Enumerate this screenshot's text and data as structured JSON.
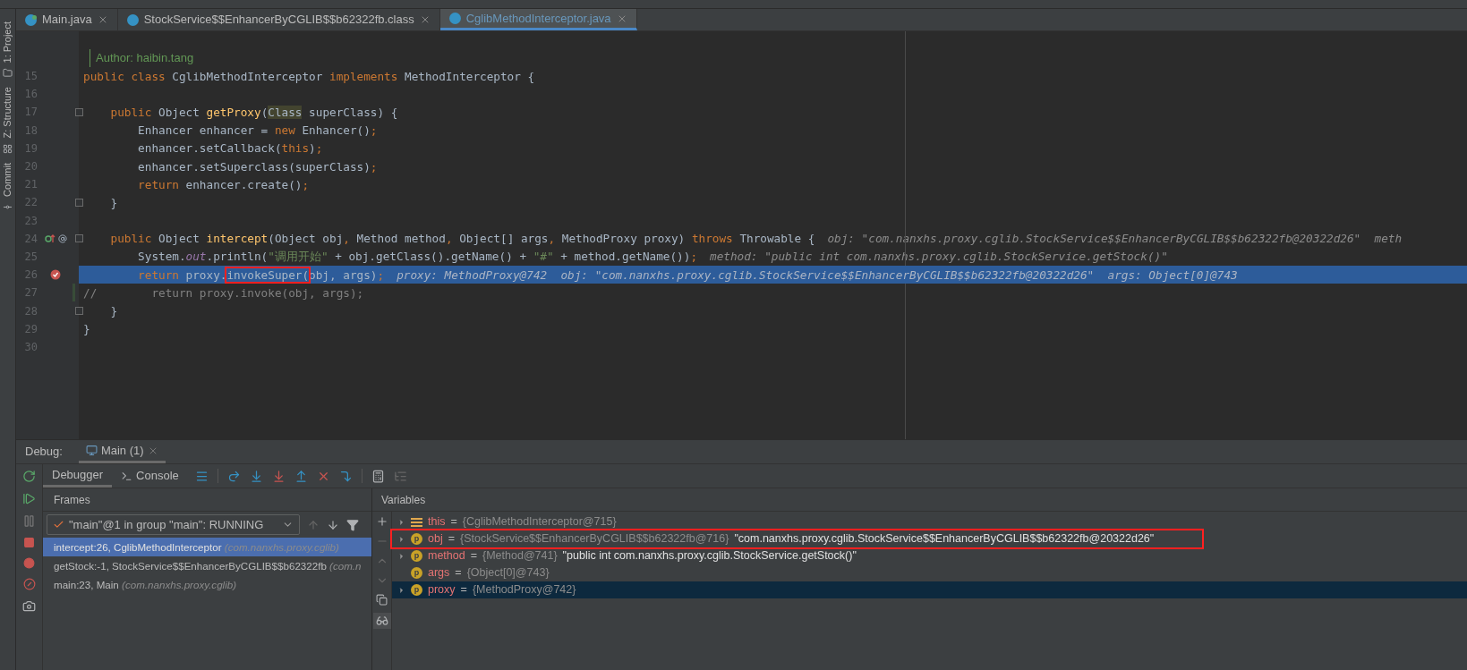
{
  "tool_strip": [
    {
      "label": "1: Project",
      "kind": "project"
    },
    {
      "label": "Z: Structure",
      "kind": "structure"
    },
    {
      "label": "Commit",
      "kind": "commit"
    }
  ],
  "editor_tabs": [
    {
      "label": "Main.java",
      "selected": false,
      "kind": "runnable"
    },
    {
      "label": "StockService$$EnhancerByCGLIB$$b62322fb.class",
      "selected": false,
      "kind": "class"
    },
    {
      "label": "CglibMethodInterceptor.java",
      "selected": true,
      "kind": "class"
    }
  ],
  "doc_lines": [
    "Author: haibin.tang"
  ],
  "code_lines": [
    {
      "number": "15",
      "tokens": [
        {
          "t": "public class ",
          "kind": "kw"
        },
        {
          "t": "CglibMethodInterceptor ",
          "kind": "plain"
        },
        {
          "t": "implements ",
          "kind": "kw"
        },
        {
          "t": "MethodInterceptor {",
          "kind": "plain"
        }
      ]
    },
    {
      "number": "16"
    },
    {
      "number": "17",
      "fold": true,
      "tokens": [
        {
          "t": "    public ",
          "kind": "kw"
        },
        {
          "t": "Object ",
          "kind": "plain"
        },
        {
          "t": "getProxy",
          "kind": "fn"
        },
        {
          "t": "(",
          "kind": "plain"
        },
        {
          "t": "Class",
          "kind": "plain",
          "marked": true
        },
        {
          "t": " superClass) {",
          "kind": "plain"
        }
      ]
    },
    {
      "number": "18",
      "tokens": [
        {
          "t": "        Enhancer enhancer = ",
          "kind": "plain"
        },
        {
          "t": "new ",
          "kind": "kw"
        },
        {
          "t": "Enhancer()",
          "kind": "plain"
        },
        {
          "t": ";",
          "kind": "kw"
        }
      ]
    },
    {
      "number": "19",
      "tokens": [
        {
          "t": "        enhancer.setCallback(",
          "kind": "plain"
        },
        {
          "t": "this",
          "kind": "kw"
        },
        {
          "t": ")",
          "kind": "plain"
        },
        {
          "t": ";",
          "kind": "kw"
        }
      ]
    },
    {
      "number": "20",
      "tokens": [
        {
          "t": "        enhancer.setSuperclass(superClass)",
          "kind": "plain"
        },
        {
          "t": ";",
          "kind": "kw"
        }
      ]
    },
    {
      "number": "21",
      "tokens": [
        {
          "t": "        return ",
          "kind": "kw"
        },
        {
          "t": "enhancer.create()",
          "kind": "plain"
        },
        {
          "t": ";",
          "kind": "kw"
        }
      ]
    },
    {
      "number": "22",
      "fold": true,
      "tokens": [
        {
          "t": "    }",
          "kind": "plain"
        }
      ]
    },
    {
      "number": "23"
    },
    {
      "number": "24",
      "fold": true,
      "kind": "implements",
      "tokens": [
        {
          "t": "    public ",
          "kind": "kw"
        },
        {
          "t": "Object ",
          "kind": "plain"
        },
        {
          "t": "intercept",
          "kind": "fn"
        },
        {
          "t": "(Object obj",
          "kind": "plain"
        },
        {
          "t": ", ",
          "kind": "kw"
        },
        {
          "t": "Method method",
          "kind": "plain"
        },
        {
          "t": ", ",
          "kind": "kw"
        },
        {
          "t": "Object[] args",
          "kind": "plain"
        },
        {
          "t": ", ",
          "kind": "kw"
        },
        {
          "t": "MethodProxy proxy) ",
          "kind": "plain"
        },
        {
          "t": "throws ",
          "kind": "kw"
        },
        {
          "t": "Throwable {",
          "kind": "plain"
        }
      ],
      "hint": "obj: \"com.nanxhs.proxy.cglib.StockService$$EnhancerByCGLIB$$b62322fb@20322d26\"  meth"
    },
    {
      "number": "25",
      "tokens": [
        {
          "t": "        System.",
          "kind": "plain"
        },
        {
          "t": "out",
          "kind": "static"
        },
        {
          "t": ".println(",
          "kind": "plain"
        },
        {
          "t": "\"调用开始\"",
          "kind": "str"
        },
        {
          "t": " + obj.getClass().getName() + ",
          "kind": "plain"
        },
        {
          "t": "\"#\"",
          "kind": "str"
        },
        {
          "t": " + method.getName())",
          "kind": "plain"
        },
        {
          "t": ";",
          "kind": "kw"
        }
      ],
      "hint": "method: \"public int com.nanxhs.proxy.cglib.StockService.getStock()\""
    },
    {
      "number": "26",
      "current": true,
      "kind": "breakpoint",
      "tokens": [
        {
          "t": "        return ",
          "kind": "kw"
        },
        {
          "t": "proxy.",
          "kind": "plain"
        },
        {
          "t": "invokeSuper(",
          "kind": "plain",
          "boxed": true
        },
        {
          "t": "obj, args)",
          "kind": "plain"
        },
        {
          "t": ";",
          "kind": "kw"
        }
      ],
      "hint": "proxy: MethodProxy@742  obj: \"com.nanxhs.proxy.cglib.StockService$$EnhancerByCGLIB$$b62322fb@20322d26\"  args: Object[0]@743"
    },
    {
      "number": "27",
      "changed": true,
      "tokens": [
        {
          "t": "//        return proxy.invoke(obj, args);",
          "kind": "comment"
        }
      ]
    },
    {
      "number": "28",
      "fold": true,
      "tokens": [
        {
          "t": "    }",
          "kind": "plain"
        }
      ]
    },
    {
      "number": "29",
      "tokens": [
        {
          "t": "}",
          "kind": "plain"
        }
      ]
    },
    {
      "number": "30"
    }
  ],
  "debug": {
    "title": "Debug:",
    "session": "Main (1)",
    "tabs": [
      {
        "label": "Debugger",
        "selected": true
      },
      {
        "label": "Console",
        "selected": false
      }
    ],
    "frames": {
      "title": "Frames",
      "thread": "\"main\"@1 in group \"main\": RUNNING",
      "items": [
        {
          "method": "intercept:26, CglibMethodInterceptor",
          "package": "(com.nanxhs.proxy.cglib)",
          "selected": true
        },
        {
          "method": "getStock:-1, StockService$$EnhancerByCGLIB$$b62322fb",
          "package": "(com.n",
          "selected": false
        },
        {
          "method": "main:23, Main",
          "package": "(com.nanxhs.proxy.cglib)",
          "selected": false
        }
      ]
    },
    "variables": {
      "title": "Variables",
      "items": [
        {
          "kind": "field",
          "name": "this",
          "eq": "=",
          "value": "{CglibMethodInterceptor@715}",
          "expandable": true,
          "selected": false,
          "outlined": false
        },
        {
          "kind": "param",
          "badge": "p",
          "name": "obj",
          "eq": "=",
          "value": "{StockService$$EnhancerByCGLIB$$b62322fb@716}",
          "text": "\"com.nanxhs.proxy.cglib.StockService$$EnhancerByCGLIB$$b62322fb@20322d26\"",
          "expandable": true,
          "selected": false,
          "outlined": true
        },
        {
          "kind": "param",
          "badge": "p",
          "name": "method",
          "eq": "=",
          "value": "{Method@741}",
          "text": "\"public int com.nanxhs.proxy.cglib.StockService.getStock()\"",
          "expandable": true,
          "selected": false,
          "outlined": false
        },
        {
          "kind": "param",
          "badge": "p",
          "name": "args",
          "eq": "=",
          "value": "{Object[0]@743}",
          "expandable": false,
          "selected": false,
          "outlined": false
        },
        {
          "kind": "param",
          "badge": "p",
          "name": "proxy",
          "eq": "=",
          "value": "{MethodProxy@742}",
          "expandable": true,
          "selected": true,
          "outlined": false
        }
      ]
    }
  }
}
